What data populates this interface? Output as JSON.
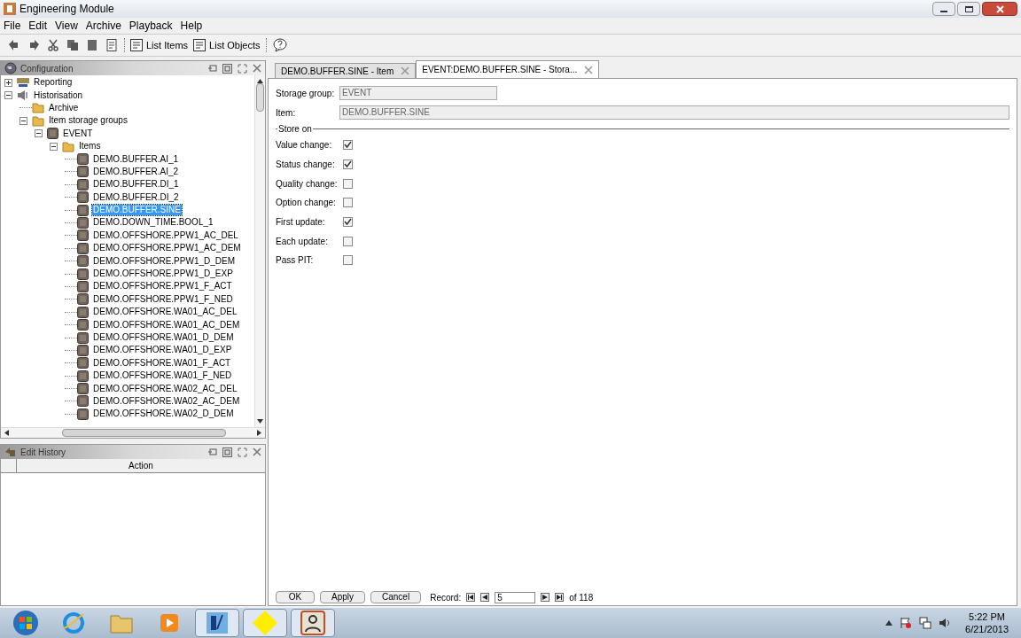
{
  "window": {
    "title": "Engineering Module"
  },
  "menu": [
    "File",
    "Edit",
    "View",
    "Archive",
    "Playback",
    "Help"
  ],
  "toolbar": [
    {
      "kind": "undo"
    },
    {
      "kind": "redo"
    },
    {
      "kind": "cut"
    },
    {
      "kind": "copy"
    },
    {
      "kind": "paste"
    },
    {
      "kind": "properties"
    },
    {
      "kind": "sep"
    },
    {
      "kind": "text",
      "label": "List Items"
    },
    {
      "kind": "text",
      "label": "List Objects"
    },
    {
      "kind": "sep"
    },
    {
      "kind": "help"
    }
  ],
  "config_panel": {
    "title": "Configuration",
    "tree": [
      {
        "label": "Reporting",
        "kind": "module",
        "expanded": false
      },
      {
        "label": "Historisation",
        "kind": "speaker",
        "expanded": true,
        "children": [
          {
            "label": "Archive",
            "kind": "folder"
          },
          {
            "label": "Item storage groups",
            "kind": "folder",
            "expanded": true,
            "children": [
              {
                "label": "EVENT",
                "kind": "item",
                "expanded": true,
                "children": [
                  {
                    "label": "Items",
                    "kind": "folder",
                    "expanded": true,
                    "children": [
                      {
                        "label": "DEMO.BUFFER.AI_1",
                        "kind": "item",
                        "selected": false
                      },
                      {
                        "label": "DEMO.BUFFER.AI_2",
                        "kind": "item",
                        "selected": false
                      },
                      {
                        "label": "DEMO.BUFFER.DI_1",
                        "kind": "item",
                        "selected": false
                      },
                      {
                        "label": "DEMO.BUFFER.DI_2",
                        "kind": "item",
                        "selected": false
                      },
                      {
                        "label": "DEMO.BUFFER.SINE",
                        "kind": "item",
                        "selected": true
                      },
                      {
                        "label": "DEMO.DOWN_TIME.BOOL_1",
                        "kind": "item",
                        "selected": false
                      },
                      {
                        "label": "DEMO.OFFSHORE.PPW1_AC_DEL",
                        "kind": "item",
                        "selected": false
                      },
                      {
                        "label": "DEMO.OFFSHORE.PPW1_AC_DEM",
                        "kind": "item",
                        "selected": false
                      },
                      {
                        "label": "DEMO.OFFSHORE.PPW1_D_DEM",
                        "kind": "item",
                        "selected": false
                      },
                      {
                        "label": "DEMO.OFFSHORE.PPW1_D_EXP",
                        "kind": "item",
                        "selected": false
                      },
                      {
                        "label": "DEMO.OFFSHORE.PPW1_F_ACT",
                        "kind": "item",
                        "selected": false
                      },
                      {
                        "label": "DEMO.OFFSHORE.PPW1_F_NED",
                        "kind": "item",
                        "selected": false
                      },
                      {
                        "label": "DEMO.OFFSHORE.WA01_AC_DEL",
                        "kind": "item",
                        "selected": false
                      },
                      {
                        "label": "DEMO.OFFSHORE.WA01_AC_DEM",
                        "kind": "item",
                        "selected": false
                      },
                      {
                        "label": "DEMO.OFFSHORE.WA01_D_DEM",
                        "kind": "item",
                        "selected": false
                      },
                      {
                        "label": "DEMO.OFFSHORE.WA01_D_EXP",
                        "kind": "item",
                        "selected": false
                      },
                      {
                        "label": "DEMO.OFFSHORE.WA01_F_ACT",
                        "kind": "item",
                        "selected": false
                      },
                      {
                        "label": "DEMO.OFFSHORE.WA01_F_NED",
                        "kind": "item",
                        "selected": false
                      },
                      {
                        "label": "DEMO.OFFSHORE.WA02_AC_DEL",
                        "kind": "item",
                        "selected": false
                      },
                      {
                        "label": "DEMO.OFFSHORE.WA02_AC_DEM",
                        "kind": "item",
                        "selected": false
                      },
                      {
                        "label": "DEMO.OFFSHORE.WA02_D_DEM",
                        "kind": "item",
                        "selected": false
                      }
                    ]
                  }
                ]
              }
            ]
          }
        ]
      }
    ]
  },
  "history_panel": {
    "title": "Edit History",
    "columns": [
      "Action"
    ]
  },
  "tabs": [
    {
      "label": "DEMO.BUFFER.SINE - Item",
      "selected": false
    },
    {
      "label": "EVENT:DEMO.BUFFER.SINE - Stora...",
      "selected": true
    }
  ],
  "form": {
    "storage_group": {
      "label": "Storage group:",
      "value": "EVENT"
    },
    "item": {
      "label": "Item:",
      "value": "DEMO.BUFFER.SINE"
    },
    "group_title": "Store on",
    "options": [
      {
        "label": "Value change:",
        "checked": true
      },
      {
        "label": "Status change:",
        "checked": true
      },
      {
        "label": "Quality change:",
        "checked": false
      },
      {
        "label": "Option change:",
        "checked": false
      },
      {
        "label": "First update:",
        "checked": true
      },
      {
        "label": "Each update:",
        "checked": false
      },
      {
        "label": "Pass PIT:",
        "checked": false
      }
    ]
  },
  "footer": {
    "buttons": [
      "OK",
      "Apply",
      "Cancel"
    ],
    "record_label": "Record:",
    "record": "5",
    "record_total": "of 118"
  },
  "taskbar": {
    "apps": [
      {
        "kind": "start"
      },
      {
        "kind": "browser"
      },
      {
        "kind": "folder"
      },
      {
        "kind": "media"
      },
      {
        "kind": "module",
        "selected": true
      },
      {
        "kind": "diamond",
        "selected": true
      },
      {
        "kind": "person",
        "selected": true
      }
    ],
    "time": "5:22 PM",
    "date": "6/21/2013"
  }
}
